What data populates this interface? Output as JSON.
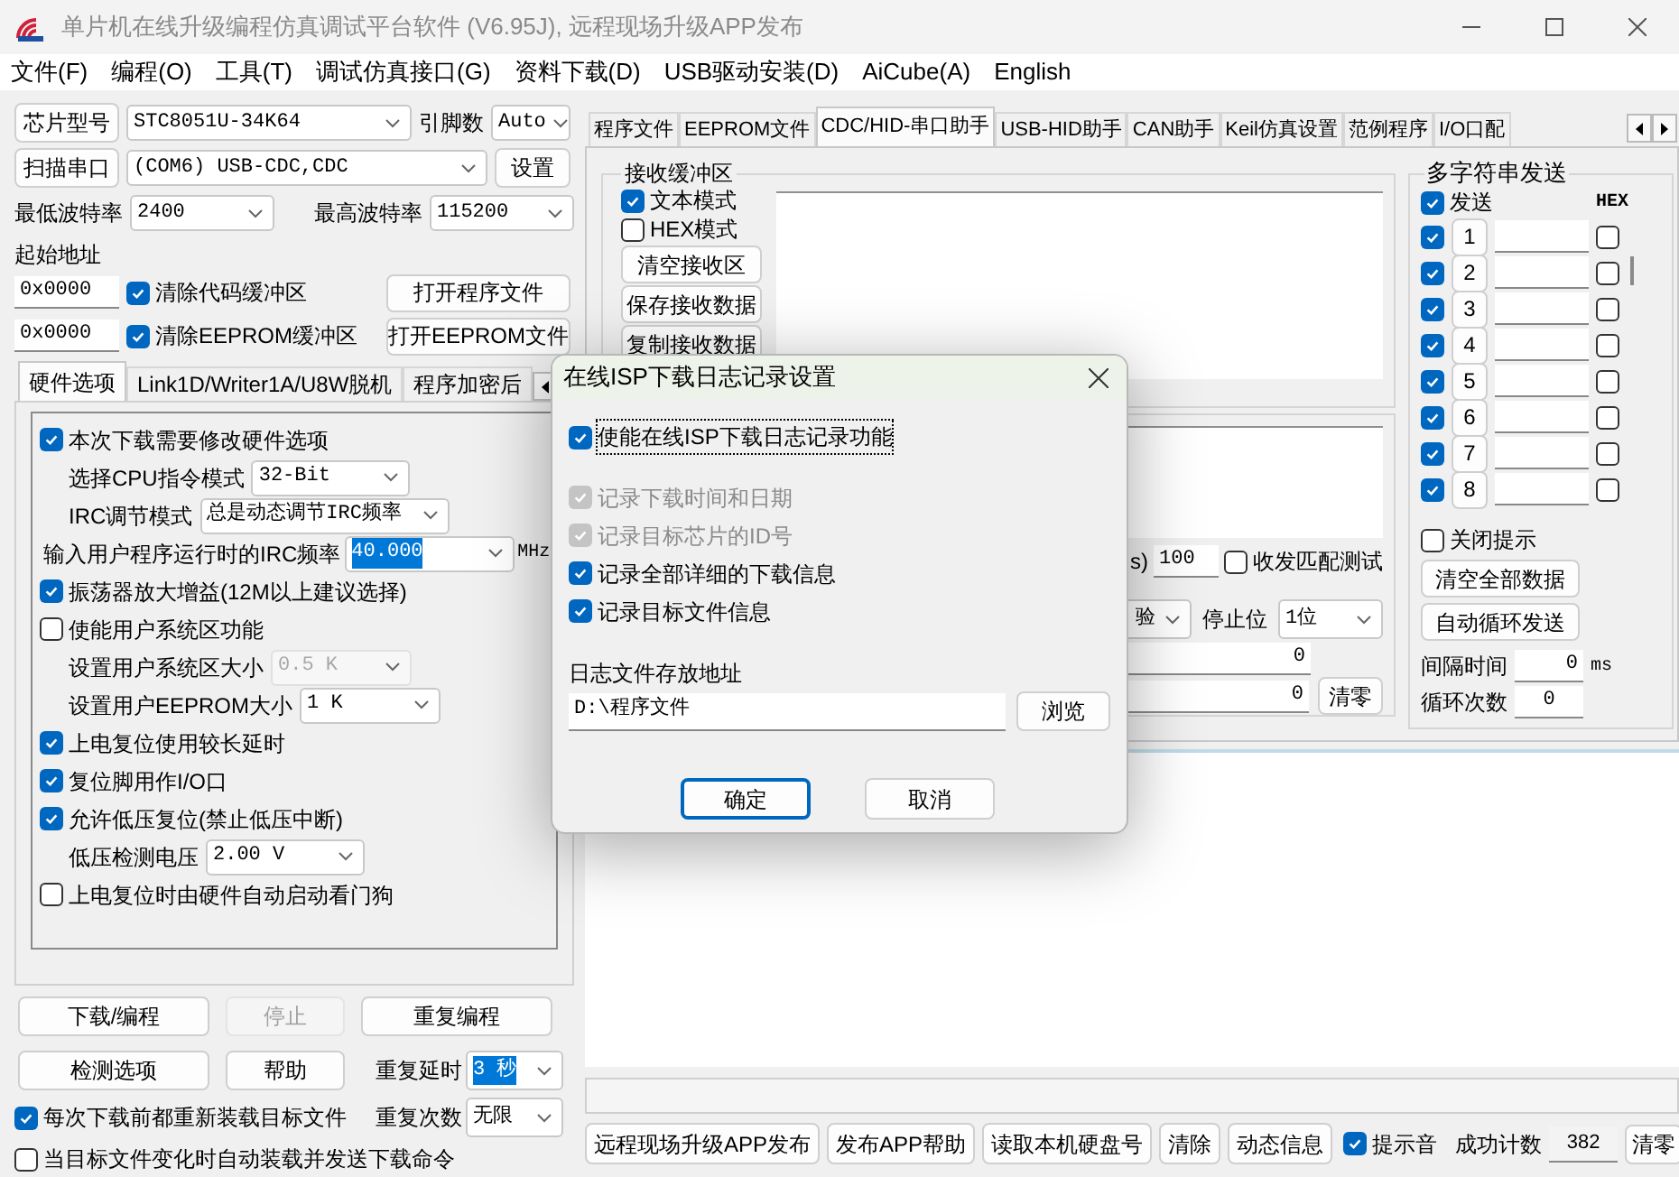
{
  "window": {
    "title": "单片机在线升级编程仿真调试平台软件 (V6.95J), 远程现场升级APP发布"
  },
  "menu": [
    "文件(F)",
    "编程(O)",
    "工具(T)",
    "调试仿真接口(G)",
    "资料下载(D)",
    "USB驱动安装(D)",
    "AiCube(A)",
    "English"
  ],
  "left": {
    "chip": {
      "button": "芯片型号",
      "value": "STC8051U-34K64",
      "pins_label": "引脚数",
      "pins": "Auto"
    },
    "port": {
      "button": "扫描串口",
      "value": "(COM6) USB-CDC,CDC",
      "settings": "设置"
    },
    "baud": {
      "min_label": "最低波特率",
      "min": "2400",
      "max_label": "最高波特率",
      "max": "115200"
    },
    "start_label": "起始地址",
    "address_rows": [
      {
        "address": "0x0000",
        "label": "清除代码缓冲区",
        "checked": true,
        "button": "打开程序文件"
      },
      {
        "address": "0x0000",
        "label": "清除EEPROM缓冲区",
        "checked": true,
        "button": "打开EEPROM文件"
      }
    ],
    "tabs": [
      {
        "label": "硬件选项",
        "selected": true
      },
      {
        "label": "Link1D/Writer1A/U8W脱机",
        "selected": false
      },
      {
        "label": "程序加密后",
        "selected": false
      }
    ],
    "options": [
      {
        "kind": "check",
        "label": "本次下载需要修改硬件选项",
        "checked": true
      },
      {
        "kind": "select",
        "label": "选择CPU指令模式",
        "value": "32-Bit",
        "disabled": false
      },
      {
        "kind": "select",
        "label": "IRC调节模式",
        "value": "总是动态调节IRC频率",
        "disabled": false
      },
      {
        "kind": "combo",
        "label": "输入用户程序运行时的IRC频率",
        "value": "40.000",
        "unit": "MHz",
        "highlighted": true
      },
      {
        "kind": "check",
        "label": "振荡器放大增益(12M以上建议选择)",
        "checked": true
      },
      {
        "kind": "check",
        "label": "使能用户系统区功能",
        "checked": false
      },
      {
        "kind": "select",
        "label": "设置用户系统区大小",
        "value": "0.5 K",
        "disabled": true
      },
      {
        "kind": "select",
        "label": "设置用户EEPROM大小",
        "value": "1 K",
        "disabled": false
      },
      {
        "kind": "check",
        "label": "上电复位使用较长延时",
        "checked": true
      },
      {
        "kind": "check",
        "label": "复位脚用作I/O口",
        "checked": true
      },
      {
        "kind": "check",
        "label": "允许低压复位(禁止低压中断)",
        "checked": true
      },
      {
        "kind": "select",
        "label": "低压检测电压",
        "value": "2.00 V",
        "disabled": false
      },
      {
        "kind": "check",
        "label": "上电复位时由硬件自动启动看门狗",
        "checked": false
      }
    ],
    "actions": [
      {
        "label": "下载/编程",
        "disabled": false
      },
      {
        "label": "停止",
        "disabled": true
      },
      {
        "label": "重复编程",
        "disabled": false
      },
      {
        "label": "检测选项",
        "disabled": false
      },
      {
        "label": "帮助",
        "disabled": false
      }
    ],
    "repeat_delay": {
      "label": "重复延时",
      "value": "3 秒",
      "highlighted": true
    },
    "repeat_count": {
      "label": "重复次数",
      "value": "无限",
      "highlighted": false
    },
    "reload": [
      {
        "label": "每次下载前都重新装载目标文件",
        "checked": true
      },
      {
        "label": "当目标文件变化时自动装载并发送下载命令",
        "checked": false
      }
    ]
  },
  "right": {
    "tabs": [
      {
        "label": "程序文件",
        "selected": false
      },
      {
        "label": "EEPROM文件",
        "selected": false
      },
      {
        "label": "CDC/HID-串口助手",
        "selected": true
      },
      {
        "label": "USB-HID助手",
        "selected": false
      },
      {
        "label": "CAN助手",
        "selected": false
      },
      {
        "label": "Keil仿真设置",
        "selected": false
      },
      {
        "label": "范例程序",
        "selected": false
      },
      {
        "label": "I/O口配",
        "selected": false
      }
    ],
    "receive": {
      "title": "接收缓冲区",
      "modes": [
        {
          "label": "文本模式",
          "checked": true
        },
        {
          "label": "HEX模式",
          "checked": false
        }
      ],
      "buttons": [
        "清空接收区",
        "保存接收数据",
        "复制接收数据"
      ]
    },
    "send": {
      "interval_unit": "s)",
      "interval": "100",
      "match": {
        "label": "收发匹配测试",
        "checked": false
      },
      "parity": "验",
      "stop_label": "停止位",
      "stop": "1位",
      "counters": [
        "0",
        "0"
      ],
      "clear": "清零"
    },
    "multi": {
      "title": "多字符串发送",
      "send": {
        "label": "发送",
        "checked": true
      },
      "hex_label": "HEX",
      "rows": [
        {
          "number": "1",
          "checked": true,
          "hex": false
        },
        {
          "number": "2",
          "checked": true,
          "hex": false
        },
        {
          "number": "3",
          "checked": true,
          "hex": false
        },
        {
          "number": "4",
          "checked": true,
          "hex": false
        },
        {
          "number": "5",
          "checked": true,
          "hex": false
        },
        {
          "number": "6",
          "checked": true,
          "hex": false
        },
        {
          "number": "7",
          "checked": true,
          "hex": false
        },
        {
          "number": "8",
          "checked": true,
          "hex": false
        }
      ],
      "close_tip": {
        "label": "关闭提示",
        "checked": false
      },
      "buttons": [
        "清空全部数据",
        "自动循环发送"
      ],
      "interval_label": "间隔时间",
      "interval": "0",
      "interval_unit": "ms",
      "loops_label": "循环次数",
      "loops": "0"
    }
  },
  "progress": {
    "level": 0
  },
  "bottom_bar": {
    "buttons": [
      "远程现场升级APP发布",
      "发布APP帮助",
      "读取本机硬盘号",
      "清除",
      "动态信息"
    ],
    "sound": {
      "label": "提示音",
      "checked": true
    },
    "count_label": "成功计数",
    "count": "382",
    "clear": "清零"
  },
  "dialog": {
    "title": "在线ISP下载日志记录设置",
    "enable": {
      "label": "使能在线ISP下载日志记录功能",
      "checked": true,
      "focused": true
    },
    "items": [
      {
        "label": "记录下载时间和日期",
        "checked": true,
        "disabled": true
      },
      {
        "label": "记录目标芯片的ID号",
        "checked": true,
        "disabled": true
      },
      {
        "label": "记录全部详细的下载信息",
        "checked": true,
        "disabled": false
      },
      {
        "label": "记录目标文件信息",
        "checked": true,
        "disabled": false
      }
    ],
    "path_label": "日志文件存放地址",
    "path": "D:\\程序文件",
    "browse": "浏览",
    "buttons": [
      {
        "label": "确定",
        "default": true
      },
      {
        "label": "取消",
        "default": false
      }
    ]
  }
}
